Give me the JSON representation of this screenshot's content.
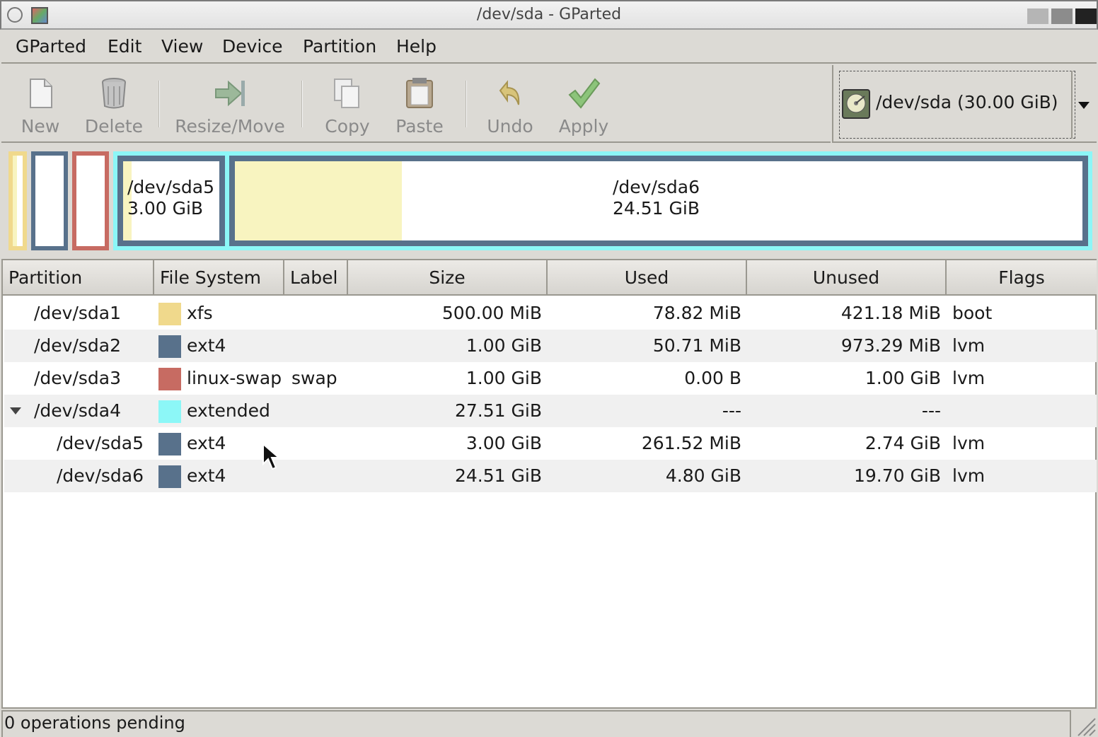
{
  "window": {
    "title": "/dev/sda - GParted"
  },
  "menubar": [
    "GParted",
    "Edit",
    "View",
    "Device",
    "Partition",
    "Help"
  ],
  "toolbar": {
    "new": "New",
    "delete": "Delete",
    "resize_move": "Resize/Move",
    "copy": "Copy",
    "paste": "Paste",
    "undo": "Undo",
    "apply": "Apply"
  },
  "device_selector": {
    "value": "/dev/sda  (30.00 GiB)"
  },
  "graph": {
    "sda5": {
      "name": "/dev/sda5",
      "size": "3.00 GiB"
    },
    "sda6": {
      "name": "/dev/sda6",
      "size": "24.51 GiB"
    }
  },
  "table": {
    "headers": {
      "partition": "Partition",
      "filesystem": "File System",
      "label": "Label",
      "size": "Size",
      "used": "Used",
      "unused": "Unused",
      "flags": "Flags"
    },
    "rows": [
      {
        "partition": "/dev/sda1",
        "filesystem": "xfs",
        "color": "#f0d98c",
        "label": "",
        "size": "500.00 MiB",
        "used": "78.82 MiB",
        "unused": "421.18 MiB",
        "flags": "boot"
      },
      {
        "partition": "/dev/sda2",
        "filesystem": "ext4",
        "color": "#58718b",
        "label": "",
        "size": "1.00 GiB",
        "used": "50.71 MiB",
        "unused": "973.29 MiB",
        "flags": "lvm"
      },
      {
        "partition": "/dev/sda3",
        "filesystem": "linux-swap",
        "color": "#c76b62",
        "label": "swap",
        "size": "1.00 GiB",
        "used": "0.00 B",
        "unused": "1.00 GiB",
        "flags": "lvm"
      },
      {
        "partition": "/dev/sda4",
        "filesystem": "extended",
        "color": "#8cf7f7",
        "label": "",
        "size": "27.51 GiB",
        "used": "---",
        "unused": "---",
        "flags": ""
      },
      {
        "partition": "/dev/sda5",
        "filesystem": "ext4",
        "color": "#58718b",
        "label": "",
        "size": "3.00 GiB",
        "used": "261.52 MiB",
        "unused": "2.74 GiB",
        "flags": "lvm"
      },
      {
        "partition": "/dev/sda6",
        "filesystem": "ext4",
        "color": "#58718b",
        "label": "",
        "size": "24.51 GiB",
        "used": "4.80 GiB",
        "unused": "19.70 GiB",
        "flags": "lvm"
      }
    ]
  },
  "statusbar": {
    "text": "0 operations pending"
  }
}
